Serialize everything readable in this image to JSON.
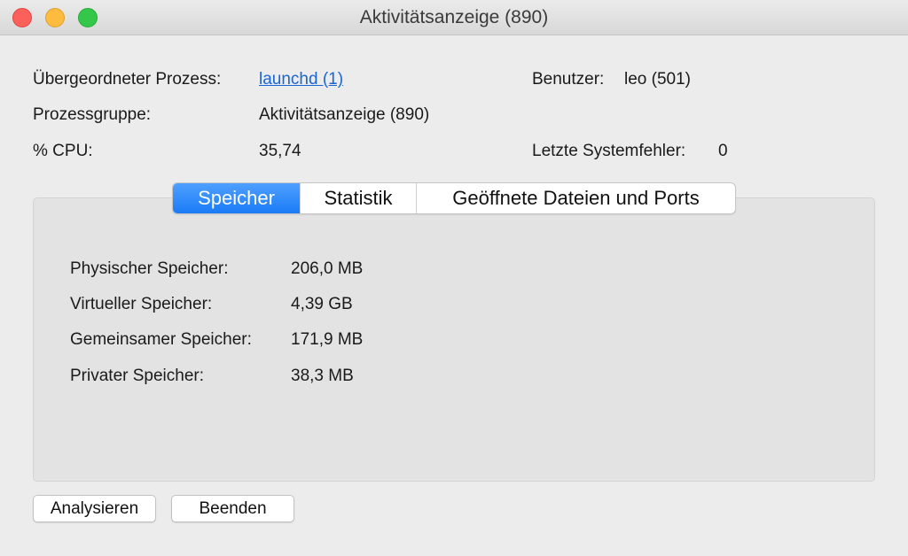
{
  "window": {
    "title": "Aktivitätsanzeige (890)"
  },
  "info": {
    "parent_label": "Übergeordneter Prozess:",
    "parent_value": "launchd (1)",
    "user_label": "Benutzer:",
    "user_value": "leo (501)",
    "group_label": "Prozessgruppe:",
    "group_value": "Aktivitätsanzeige (890)",
    "cpu_label": "% CPU:",
    "cpu_value": "35,74",
    "faults_label": "Letzte Systemfehler:",
    "faults_value": "0"
  },
  "tabs": [
    {
      "label": "Speicher",
      "active": true
    },
    {
      "label": "Statistik",
      "active": false
    },
    {
      "label": "Geöffnete Dateien und Ports",
      "active": false
    }
  ],
  "memory": [
    {
      "label": "Physischer Speicher:",
      "value": "206,0 MB"
    },
    {
      "label": "Virtueller Speicher:",
      "value": "4,39 GB"
    },
    {
      "label": "Gemeinsamer Speicher:",
      "value": "171,9 MB"
    },
    {
      "label": "Privater Speicher:",
      "value": "38,3 MB"
    }
  ],
  "buttons": {
    "analyze": "Analysieren",
    "quit": "Beenden"
  },
  "colors": {
    "accent": "#1a7bf6",
    "link": "#1a66d4"
  }
}
